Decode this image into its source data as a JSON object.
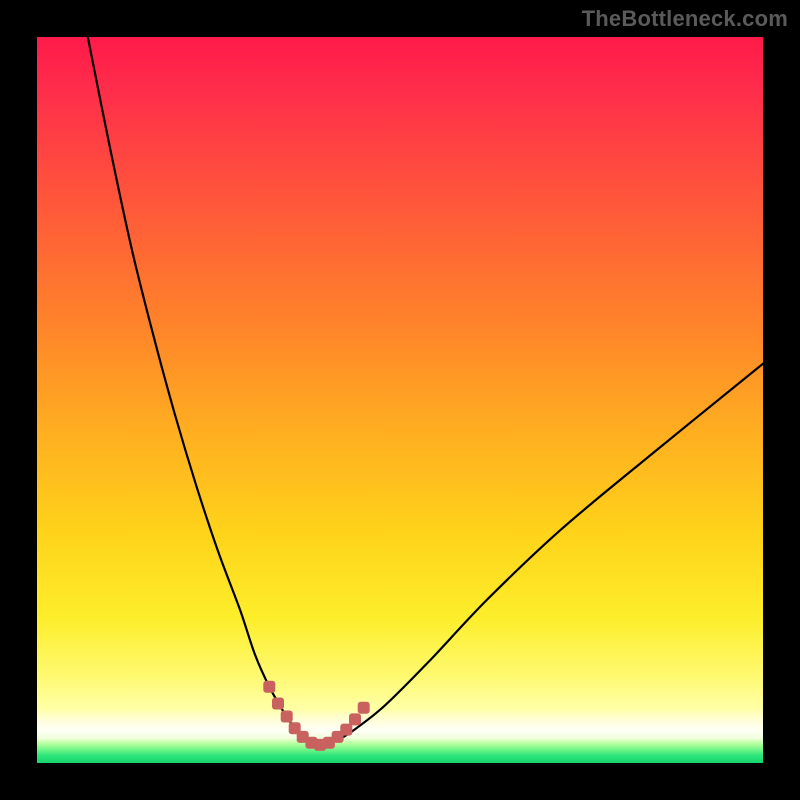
{
  "watermark": "TheBottleneck.com",
  "colors": {
    "frame": "#000000",
    "curve": "#000000",
    "marker": "#c9625f",
    "gradient_top": "#ff1a4a",
    "gradient_mid": "#ffd21a",
    "gradient_bottom": "#16d66d"
  },
  "chart_data": {
    "type": "line",
    "title": "",
    "xlabel": "",
    "ylabel": "",
    "xlim": [
      0,
      100
    ],
    "ylim": [
      0,
      100
    ],
    "grid": false,
    "legend": false,
    "annotations": [],
    "series": [
      {
        "name": "bottleneck-curve",
        "x": [
          7,
          10,
          13,
          16,
          19,
          22,
          25,
          28,
          30,
          32,
          34,
          35.5,
          37,
          38,
          39.5,
          41.5,
          44,
          48,
          54,
          62,
          72,
          84,
          100
        ],
        "y": [
          100,
          85,
          71,
          59,
          48,
          38,
          29,
          21,
          15,
          10.5,
          7,
          4.8,
          3.2,
          2.5,
          2.5,
          3.2,
          4.8,
          8,
          14,
          22.5,
          32,
          42,
          55
        ]
      }
    ],
    "markers": {
      "name": "highlighted-segment",
      "x": [
        32,
        33.2,
        34.4,
        35.5,
        36.6,
        37.8,
        39,
        40.2,
        41.4,
        42.6,
        43.8,
        45
      ],
      "y": [
        10.5,
        8.2,
        6.4,
        4.8,
        3.6,
        2.8,
        2.5,
        2.8,
        3.6,
        4.6,
        6.0,
        7.6
      ]
    }
  }
}
